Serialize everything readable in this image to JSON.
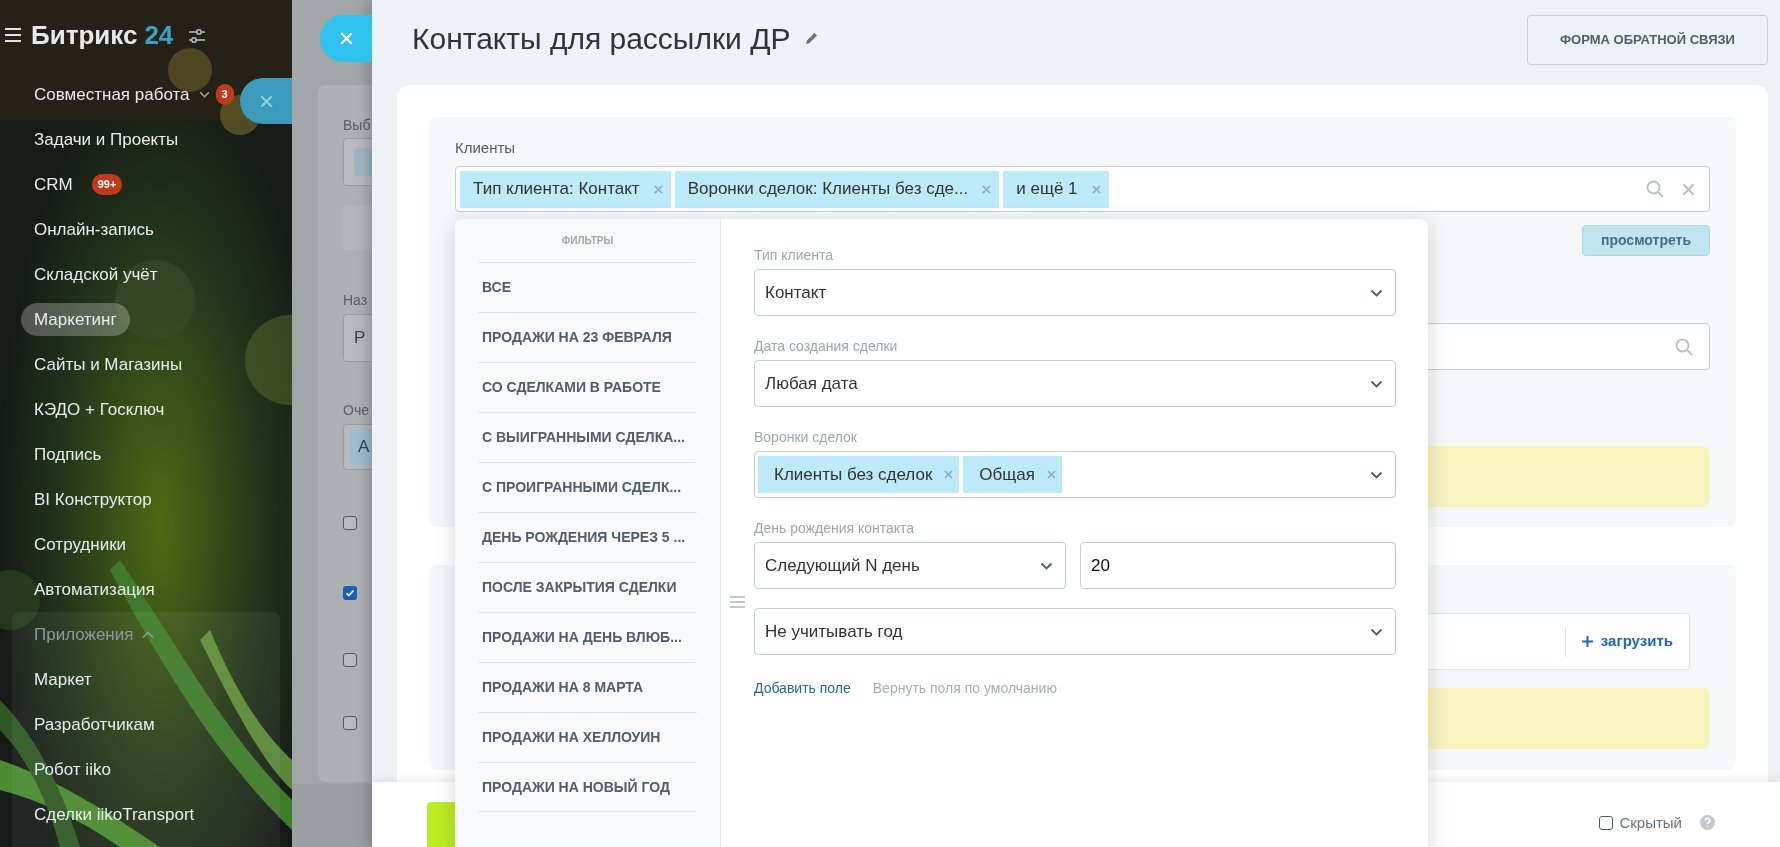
{
  "sidebar": {
    "logo": {
      "brand": "Битрикс",
      "number": "24"
    },
    "items": [
      {
        "kind": "item",
        "label": "Совместная работа",
        "selected": false,
        "expanded": false,
        "badge": "3"
      },
      {
        "kind": "item",
        "label": "Задачи и Проекты",
        "selected": false
      },
      {
        "kind": "item",
        "label": "CRM",
        "selected": false,
        "badge": "99+"
      },
      {
        "kind": "item",
        "label": "Онлайн-запись",
        "selected": false
      },
      {
        "kind": "item",
        "label": "Складской учёт",
        "selected": false
      },
      {
        "kind": "item",
        "label": "Маркетинг",
        "selected": true
      },
      {
        "kind": "item",
        "label": "Сайты и Магазины",
        "selected": false
      },
      {
        "kind": "item",
        "label": "КЭДО + Госключ",
        "selected": false
      },
      {
        "kind": "item",
        "label": "Подпись",
        "selected": false
      },
      {
        "kind": "item",
        "label": "BI Конструктор",
        "selected": false
      },
      {
        "kind": "item",
        "label": "Сотрудники",
        "selected": false
      },
      {
        "kind": "item",
        "label": "Автоматизация",
        "selected": false
      },
      {
        "kind": "group",
        "label": "Приложения",
        "selected": false,
        "expanded": true,
        "children": [
          {
            "label": "Маркет",
            "selected": false
          },
          {
            "label": "Разработчикам",
            "selected": false
          },
          {
            "label": "Робот iiko",
            "selected": false
          },
          {
            "label": "Сделки iikoTransport",
            "selected": false
          }
        ]
      }
    ]
  },
  "background_panel": {
    "labels": [
      "Выб",
      "Наз",
      "Оче"
    ],
    "name_value": "Р",
    "queue_tag": "А",
    "checkboxes": [
      {
        "checked": false
      },
      {
        "checked": true
      },
      {
        "checked": false
      },
      {
        "checked": false
      }
    ]
  },
  "slider": {
    "title": "Контакты для рассылки ДР",
    "feedback_button": "ФОРМА ОБРАТНОЙ СВЯЗИ",
    "recipients": {
      "label": "Клиенты",
      "tags": [
        "Тип клиента: Контакт",
        "Воронки сделок: Клиенты без сде...",
        "и ещё 1"
      ],
      "preview_button": "просмотреть"
    },
    "upload_button": "загрузить",
    "footer": {
      "hidden": {
        "label": "Скрытый",
        "checked": false
      }
    }
  },
  "filter_popup": {
    "heading": "ФИЛЬТРЫ",
    "presets": [
      "ВСЕ",
      "ПРОДАЖИ НА 23 ФЕВРАЛЯ",
      "СО СДЕЛКАМИ В РАБОТЕ",
      "С ВЫИГРАННЫМИ СДЕЛКА...",
      "С ПРОИГРАННЫМИ СДЕЛК...",
      "ДЕНЬ РОЖДЕНИЯ ЧЕРЕЗ 5 ...",
      "ПОСЛЕ ЗАКРЫТИЯ СДЕЛКИ",
      "ПРОДАЖИ НА ДЕНЬ ВЛЮБ...",
      "ПРОДАЖИ НА 8 МАРТА",
      "ПРОДАЖИ НА ХЕЛЛОУИН",
      "ПРОДАЖИ НА НОВЫЙ ГОД"
    ],
    "fields": [
      {
        "kind": "select",
        "label": "Тип клиента",
        "value": "Контакт"
      },
      {
        "kind": "select",
        "label": "Дата создания сделки",
        "value": "Любая дата"
      },
      {
        "kind": "tags",
        "label": "Воронки сделок",
        "tags": [
          "Клиенты без сделок",
          "Общая"
        ]
      },
      {
        "kind": "select_input",
        "label": "День рождения контакта",
        "value": "Следующий N день",
        "input": "20"
      },
      {
        "kind": "select",
        "value": "Не учитывать год"
      }
    ],
    "add_field_link": "Добавить поле",
    "reset_link": "Вернуть поля по умолчанию"
  }
}
